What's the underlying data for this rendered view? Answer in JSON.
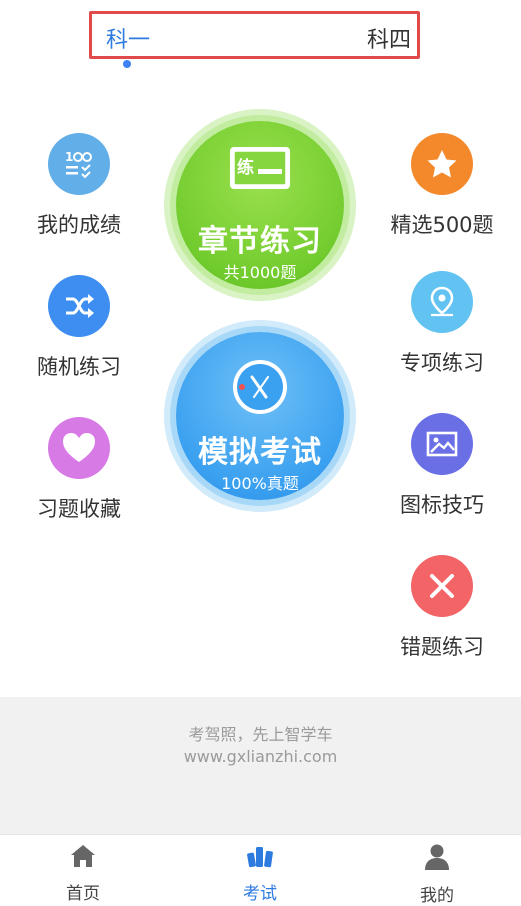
{
  "top_tabs": {
    "items": [
      "科一",
      "科四"
    ],
    "active": "科一"
  },
  "left_items": [
    {
      "label": "我的成绩",
      "icon": "score-icon",
      "color": "#62aee8"
    },
    {
      "label": "随机练习",
      "icon": "shuffle-icon",
      "color": "#3d8ef0"
    },
    {
      "label": "习题收藏",
      "icon": "heart-icon",
      "color": "#d77ae6"
    }
  ],
  "right_items": [
    {
      "label": "精选500题",
      "icon": "star-icon",
      "color": "#f4892c"
    },
    {
      "label": "专项练习",
      "icon": "location-icon",
      "color": "#62c3f2"
    },
    {
      "label": "图标技巧",
      "icon": "image-icon",
      "color": "#6a6fe6"
    },
    {
      "label": "错题练习",
      "icon": "wrong-icon",
      "color": "#f26466"
    }
  ],
  "chapter_practice": {
    "badge": "练",
    "title": "章节练习",
    "subtitle": "共1000题",
    "color": "#72cc2e"
  },
  "mock_exam": {
    "title": "模拟考试",
    "subtitle": "100%真题",
    "color": "#3aa0f0"
  },
  "promo": {
    "line1": "考驾照，先上智学车",
    "line2": "www.gxlianzhi.com"
  },
  "bottom_nav": [
    {
      "label": "首页",
      "icon": "home-icon"
    },
    {
      "label": "考试",
      "icon": "exam-icon",
      "active": true
    },
    {
      "label": "我的",
      "icon": "profile-icon"
    }
  ]
}
